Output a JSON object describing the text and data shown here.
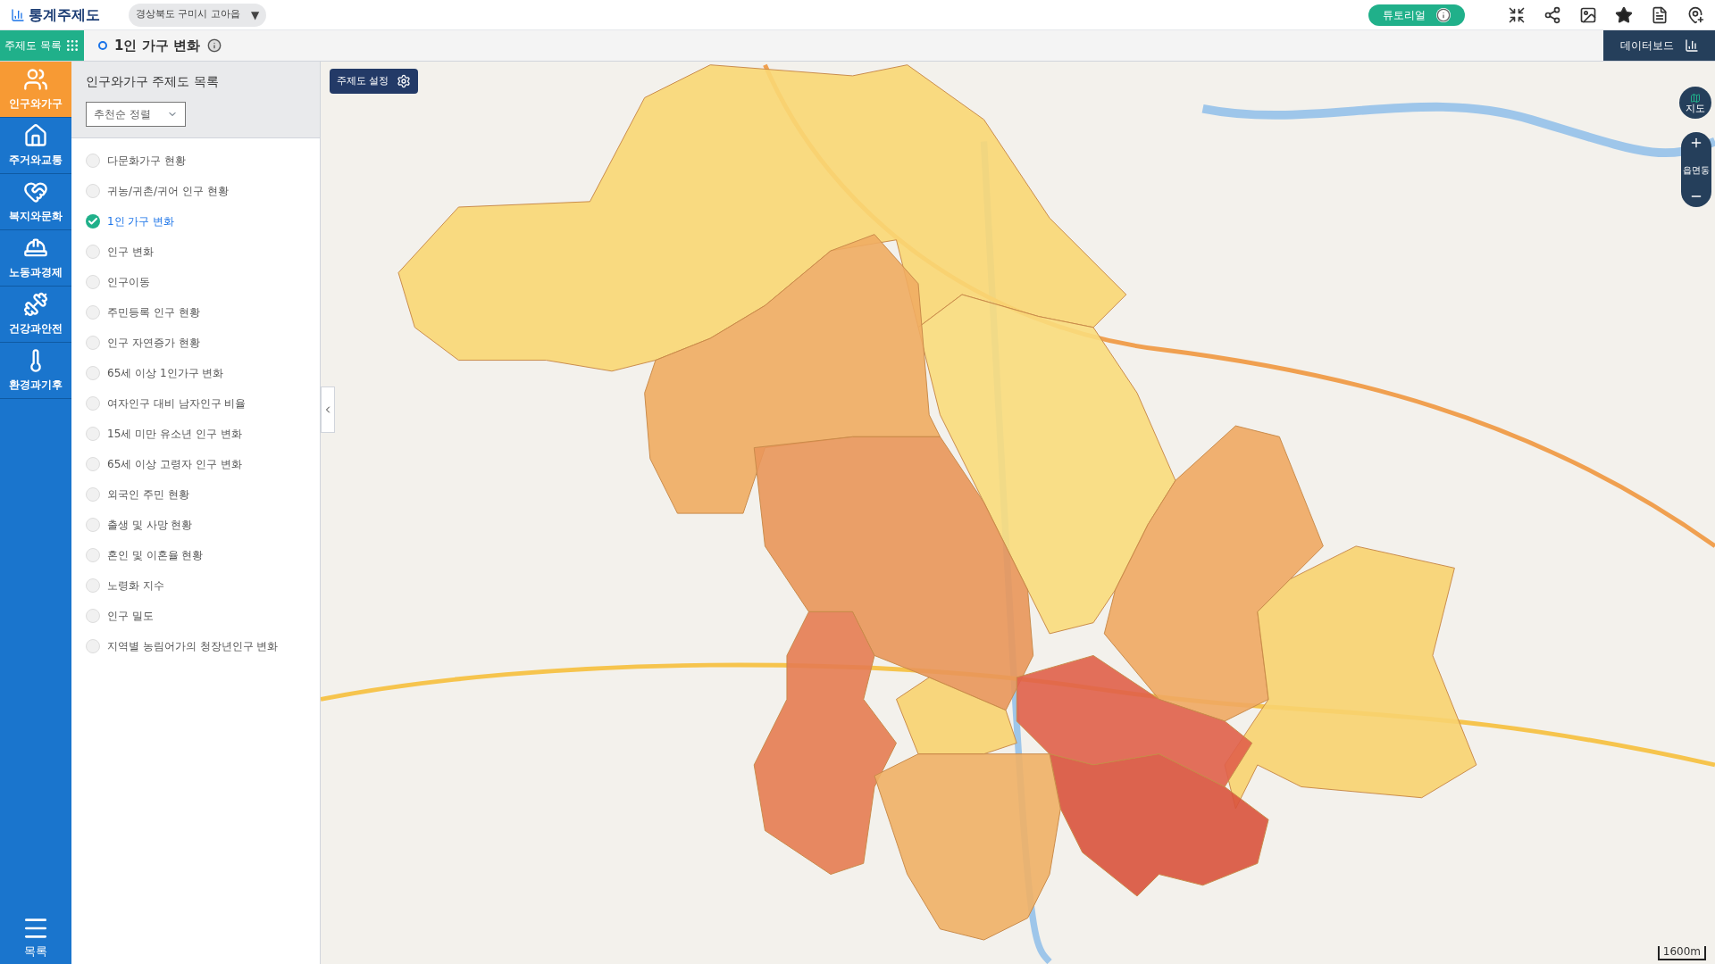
{
  "header": {
    "logo": "통계주제도",
    "region": "경상북도 구미시 고아읍",
    "region_caret": "▼",
    "tutorial": "튜토리얼"
  },
  "toolbar": {
    "list_button": "주제도 목록",
    "current_title": "1인 가구 변화",
    "dashboard": "데이터보드"
  },
  "categories": [
    {
      "label": "인구와가구",
      "selected": true
    },
    {
      "label": "주거와교통",
      "selected": false
    },
    {
      "label": "복지와문화",
      "selected": false
    },
    {
      "label": "노동과경제",
      "selected": false
    },
    {
      "label": "건강과안전",
      "selected": false
    },
    {
      "label": "환경과기후",
      "selected": false
    }
  ],
  "menu": "목록",
  "panel": {
    "title": "인구와가구 주제도 목록",
    "sort": "추천순 정렬",
    "items": [
      {
        "label": "다문화가구 현황",
        "selected": false
      },
      {
        "label": "귀농/귀촌/귀어 인구 현황",
        "selected": false
      },
      {
        "label": "1인 가구 변화",
        "selected": true
      },
      {
        "label": "인구 변화",
        "selected": false
      },
      {
        "label": "인구이동",
        "selected": false
      },
      {
        "label": "주민등록 인구 현황",
        "selected": false
      },
      {
        "label": "인구 자연증가 현황",
        "selected": false
      },
      {
        "label": "65세 이상 1인가구 변화",
        "selected": false
      },
      {
        "label": "여자인구 대비 남자인구 비율",
        "selected": false
      },
      {
        "label": "15세 미만 유소년 인구 변화",
        "selected": false
      },
      {
        "label": "65세 이상 고령자 인구 변화",
        "selected": false
      },
      {
        "label": "외국인 주민 현황",
        "selected": false
      },
      {
        "label": "출생 및 사망 현황",
        "selected": false
      },
      {
        "label": "혼인 및 이혼율 현황",
        "selected": false
      },
      {
        "label": "노령화 지수",
        "selected": false
      },
      {
        "label": "인구 밀도",
        "selected": false
      },
      {
        "label": "지역별 농림어가의 청장년인구 변화",
        "selected": false
      }
    ]
  },
  "map": {
    "settings": "주제도 설정",
    "map_button": "지도",
    "zoom_label": "읍면동",
    "scale": "1600m"
  }
}
